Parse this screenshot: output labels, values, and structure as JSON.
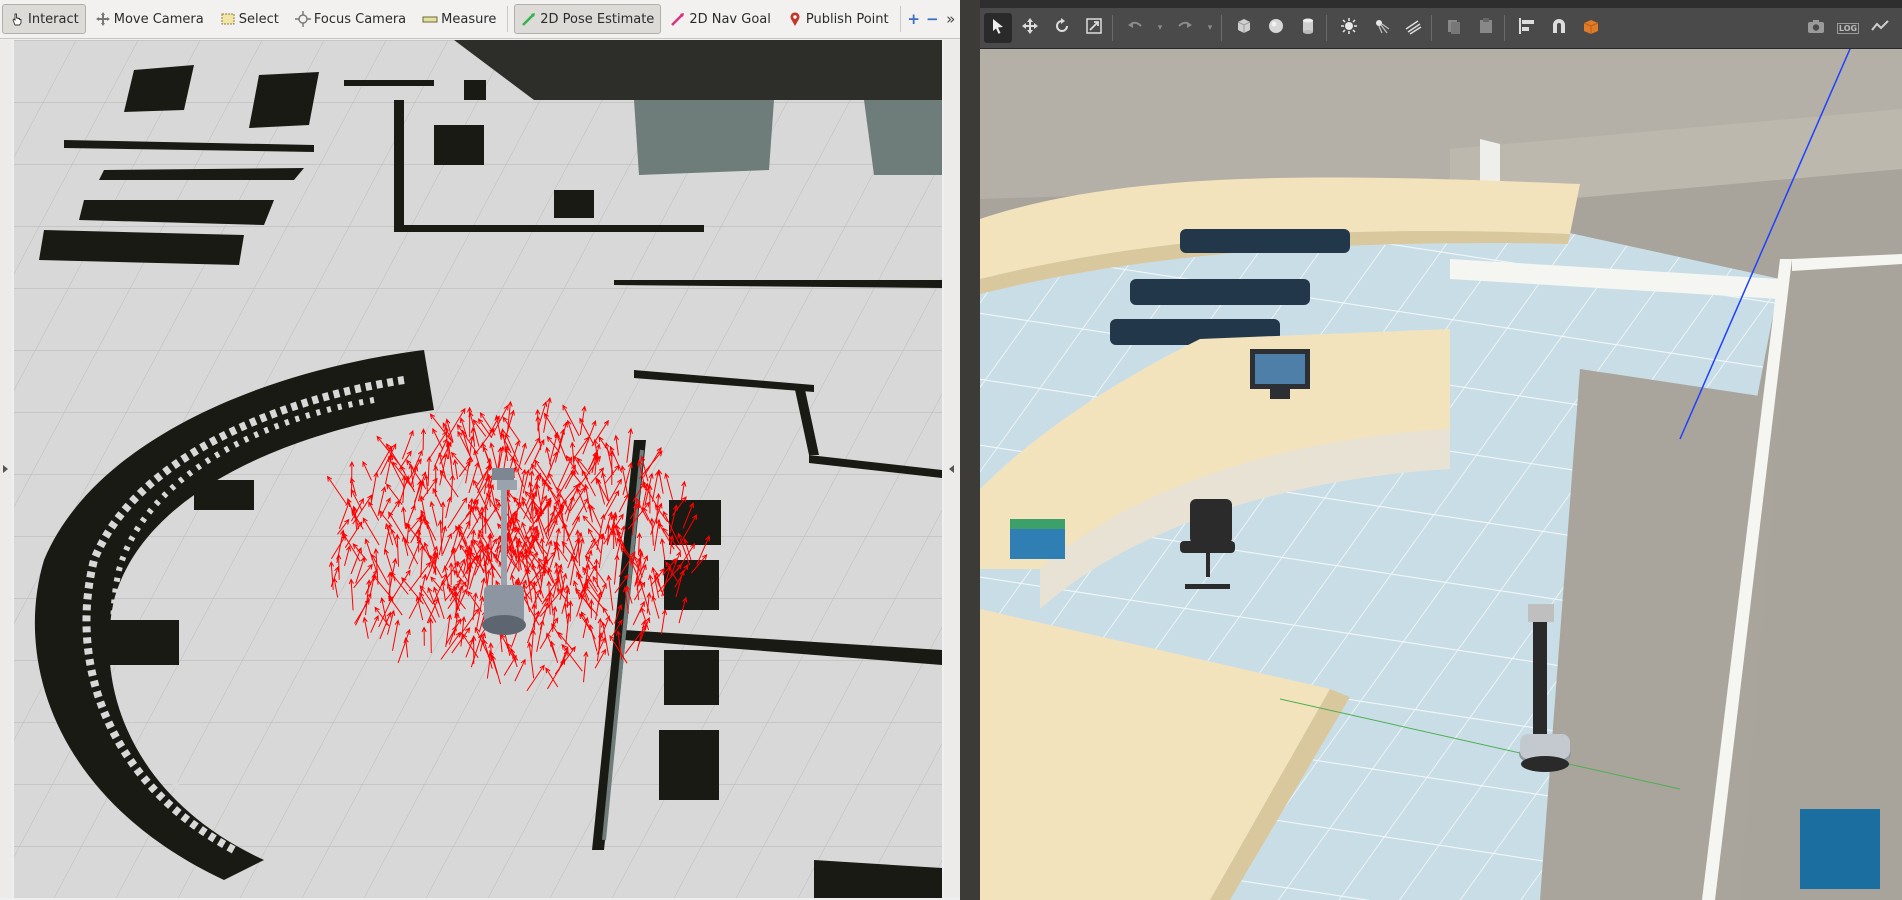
{
  "rviz": {
    "tools": [
      {
        "label": "Interact",
        "icon": "hand-pointer-icon",
        "active": true
      },
      {
        "label": "Move Camera",
        "icon": "move-camera-icon",
        "active": false
      },
      {
        "label": "Select",
        "icon": "select-box-icon",
        "active": false
      },
      {
        "label": "Focus Camera",
        "icon": "focus-target-icon",
        "active": false
      },
      {
        "label": "Measure",
        "icon": "ruler-icon",
        "active": false
      },
      {
        "label": "2D Pose Estimate",
        "icon": "green-arrow-icon",
        "active": true
      },
      {
        "label": "2D Nav Goal",
        "icon": "pink-arrow-icon",
        "active": false
      },
      {
        "label": "Publish Point",
        "icon": "map-pin-icon",
        "active": false
      }
    ],
    "add_tool_symbol": "+",
    "remove_tool_symbol": "−",
    "overflow_symbol": "»",
    "colors": {
      "particles": "#ff0000",
      "occupied": "#1a1a14",
      "free": "#d9d9d9",
      "unknown": "#6e7d7a"
    }
  },
  "gazebo": {
    "tools": [
      {
        "name": "select-mode",
        "icon": "cursor-arrow-icon"
      },
      {
        "name": "translate-mode",
        "icon": "move-cross-icon"
      },
      {
        "name": "rotate-mode",
        "icon": "rotate-icon"
      },
      {
        "name": "scale-mode",
        "icon": "scale-icon"
      },
      {
        "name": "undo",
        "icon": "undo-icon"
      },
      {
        "name": "redo",
        "icon": "redo-icon"
      },
      {
        "name": "box-shape",
        "icon": "box-icon"
      },
      {
        "name": "sphere-shape",
        "icon": "sphere-icon"
      },
      {
        "name": "cylinder-shape",
        "icon": "cylinder-icon"
      },
      {
        "name": "point-light",
        "icon": "sun-icon"
      },
      {
        "name": "spot-light",
        "icon": "spot-light-icon"
      },
      {
        "name": "directional-light",
        "icon": "directional-light-icon"
      },
      {
        "name": "copy",
        "icon": "copy-icon"
      },
      {
        "name": "paste",
        "icon": "paste-icon"
      },
      {
        "name": "align",
        "icon": "align-icon"
      },
      {
        "name": "snap",
        "icon": "magnet-icon"
      },
      {
        "name": "change-view",
        "icon": "view-cube-icon"
      },
      {
        "name": "screenshot",
        "icon": "camera-icon"
      },
      {
        "name": "log",
        "icon": "log-icon"
      },
      {
        "name": "plot",
        "icon": "plot-icon"
      }
    ],
    "log_label": "LOG",
    "colors": {
      "floor": "#c9dde6",
      "desk": "#f3e3bd",
      "wall": "#b7b2a8",
      "chairs": "#22384a"
    }
  }
}
